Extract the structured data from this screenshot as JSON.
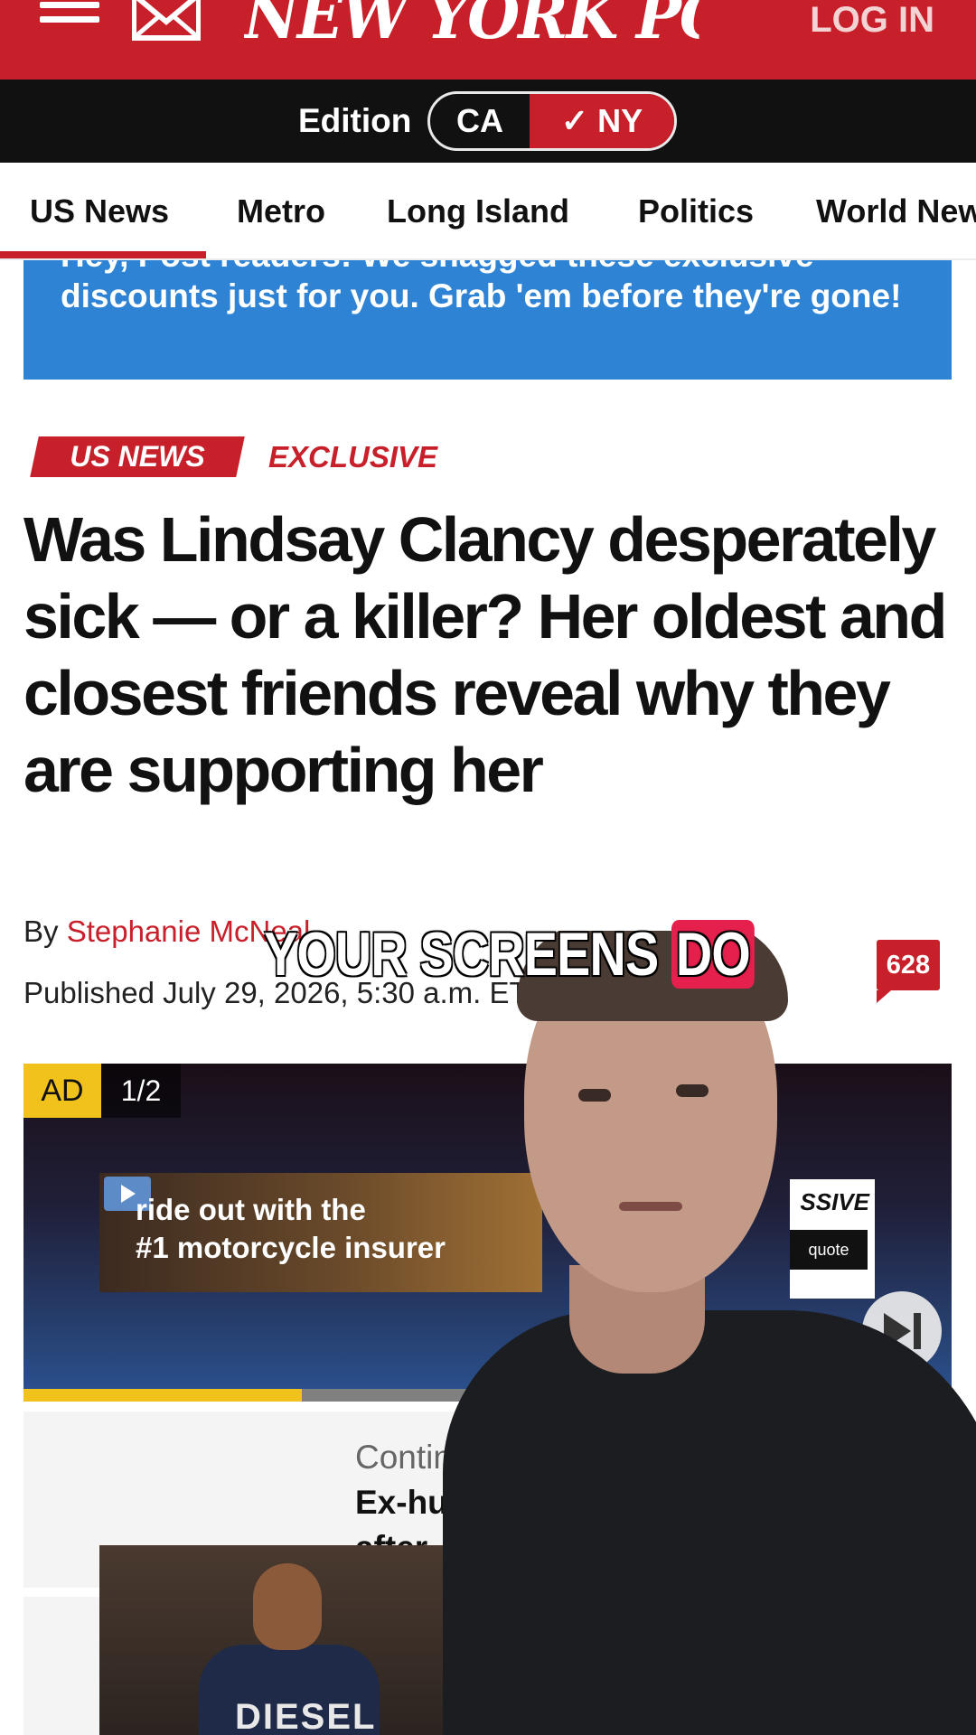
{
  "header": {
    "logo": "NEW YORK POST",
    "login_label": "LOG IN",
    "icons": [
      "menu-icon",
      "mail-icon"
    ],
    "colors": {
      "brand_red": "#c8202a",
      "edition_bar": "#111111"
    }
  },
  "edition": {
    "label": "Edition",
    "options": [
      "CA",
      "NY"
    ],
    "selected": "NY",
    "selected_mark": "✓ NY"
  },
  "nav": {
    "tabs": [
      "US News",
      "Metro",
      "Long Island",
      "Politics",
      "World News"
    ],
    "active": "US News"
  },
  "promo": {
    "text": "Hey, Post readers: We snagged these exclusive discounts just for you. Grab 'em before they're gone!",
    "color": "#2f83d4"
  },
  "article": {
    "section": "US NEWS",
    "tag": "EXCLUSIVE",
    "headline": "Was Lindsay Clancy desperately sick — or a killer? Her oldest and closest friends reveal why they are supporting her",
    "byline_prefix": "By",
    "author": "Stephanie McNeal",
    "published": "Published July 29, 2026, 5:30 a.m. ET",
    "comment_count": "628"
  },
  "ad": {
    "badge": "AD",
    "count": "1/2",
    "line1": "ride out with the",
    "line2": "#1 motorcycle insurer",
    "brand": "SSIVE",
    "cta": "quote",
    "progress": 0.3,
    "skip_icon": "skip-next-icon"
  },
  "continued": {
    "label": "Continue reading",
    "title": "Ex-hu",
    "subtitle": "after",
    "thumb_text": "DIESEL"
  },
  "caption": {
    "text": "YOUR SCREENS",
    "highlight": "DO",
    "highlight_color": "#e5204d"
  }
}
